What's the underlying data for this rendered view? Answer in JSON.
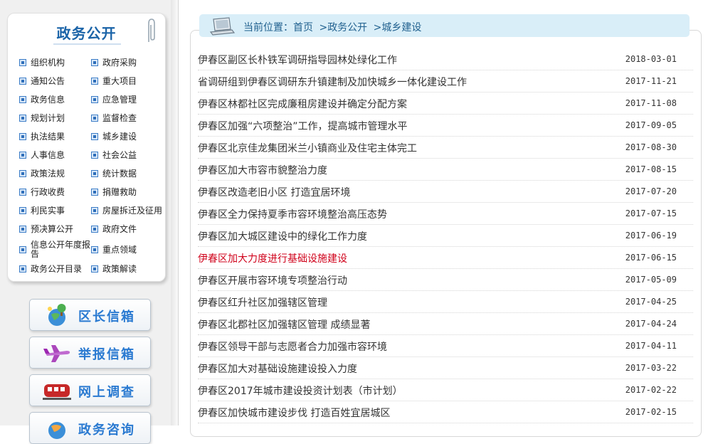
{
  "sidebar": {
    "panel_title": "政务公开",
    "items": [
      {
        "label": "组织机构"
      },
      {
        "label": "政府采购"
      },
      {
        "label": "通知公告"
      },
      {
        "label": "重大项目"
      },
      {
        "label": "政务信息"
      },
      {
        "label": "应急管理"
      },
      {
        "label": "规划计划"
      },
      {
        "label": "监督检查"
      },
      {
        "label": "执法结果"
      },
      {
        "label": "城乡建设"
      },
      {
        "label": "人事信息"
      },
      {
        "label": "社会公益"
      },
      {
        "label": "政策法规"
      },
      {
        "label": "统计数据"
      },
      {
        "label": "行政收费"
      },
      {
        "label": "捐赠救助"
      },
      {
        "label": "利民实事"
      },
      {
        "label": "房屋拆迁及征用"
      },
      {
        "label": "预决算公开"
      },
      {
        "label": "政府文件"
      },
      {
        "label": "信息公开年度报告"
      },
      {
        "label": "重点领域"
      },
      {
        "label": "政务公开目录"
      },
      {
        "label": "政策解读"
      }
    ],
    "buttons": [
      {
        "label": "区长信箱",
        "icon": "globe-tree-icon"
      },
      {
        "label": "举报信箱",
        "icon": "airplane-icon"
      },
      {
        "label": "网上调查",
        "icon": "train-icon"
      },
      {
        "label": "政务咨询",
        "icon": "globe-icon"
      }
    ]
  },
  "breadcrumb": {
    "prefix": "当前位置：",
    "home": "首页",
    "sep": ">",
    "level1": "政务公开",
    "level2": "城乡建设"
  },
  "news": [
    {
      "title": "伊春区副区长朴铁军调研指导园林处绿化工作",
      "date": "2018-03-01"
    },
    {
      "title": "省调研组到伊春区调研东升镇建制及加快城乡一体化建设工作",
      "date": "2017-11-21"
    },
    {
      "title": "伊春区林都社区完成廉租房建设并确定分配方案",
      "date": "2017-11-08"
    },
    {
      "title": "伊春区加强“六项整治”工作，提高城市管理水平",
      "date": "2017-09-05"
    },
    {
      "title": "伊春区北京佳龙集团米兰小镇商业及住宅主体完工",
      "date": "2017-08-30"
    },
    {
      "title": "伊春区加大市容市貌整治力度",
      "date": "2017-08-15"
    },
    {
      "title": "伊春区改造老旧小区 打造宜居环境",
      "date": "2017-07-20"
    },
    {
      "title": "伊春区全力保持夏季市容环境整治高压态势",
      "date": "2017-07-15"
    },
    {
      "title": "伊春区加大城区建设中的绿化工作力度",
      "date": "2017-06-19"
    },
    {
      "title": "伊春区加大力度进行基础设施建设",
      "date": "2017-06-15",
      "highlight": true
    },
    {
      "title": "伊春区开展市容环境专项整治行动",
      "date": "2017-05-09"
    },
    {
      "title": "伊春区红升社区加强辖区管理",
      "date": "2017-04-25"
    },
    {
      "title": "伊春区北郡社区加强辖区管理 成绩显著",
      "date": "2017-04-24"
    },
    {
      "title": "伊春区领导干部与志愿者合力加强市容环境",
      "date": "2017-04-11"
    },
    {
      "title": "伊春区加大对基础设施建设投入力度",
      "date": "2017-03-22"
    },
    {
      "title": "伊春区2017年城市建设投资计划表（市计划）",
      "date": "2017-02-22"
    },
    {
      "title": "伊春区加快城市建设步伐 打造百姓宜居城区",
      "date": "2017-02-15"
    }
  ],
  "colors": {
    "accent": "#2a7ad1",
    "breadcrumb_bg": "#d9eef8",
    "highlight_red": "#d0021b"
  }
}
